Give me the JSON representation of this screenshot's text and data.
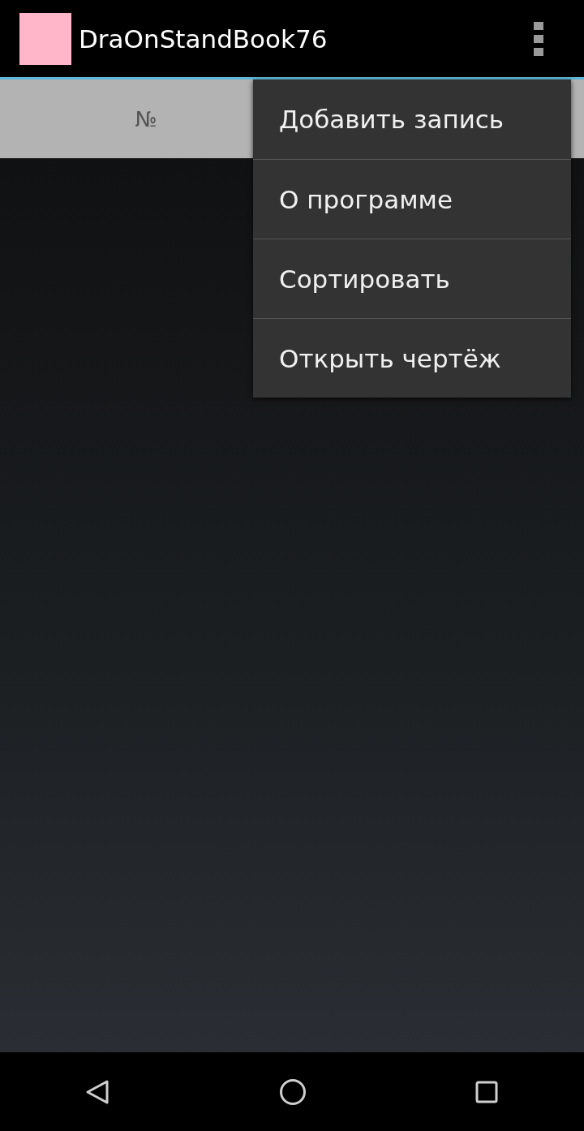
{
  "action_bar": {
    "title": "DraOnStandBook76"
  },
  "table": {
    "columns": [
      {
        "label": "№"
      }
    ]
  },
  "menu": {
    "items": [
      {
        "label": "Добавить запись"
      },
      {
        "label": "О программе"
      },
      {
        "label": "Сортировать"
      },
      {
        "label": "Открыть чертёж"
      }
    ]
  }
}
